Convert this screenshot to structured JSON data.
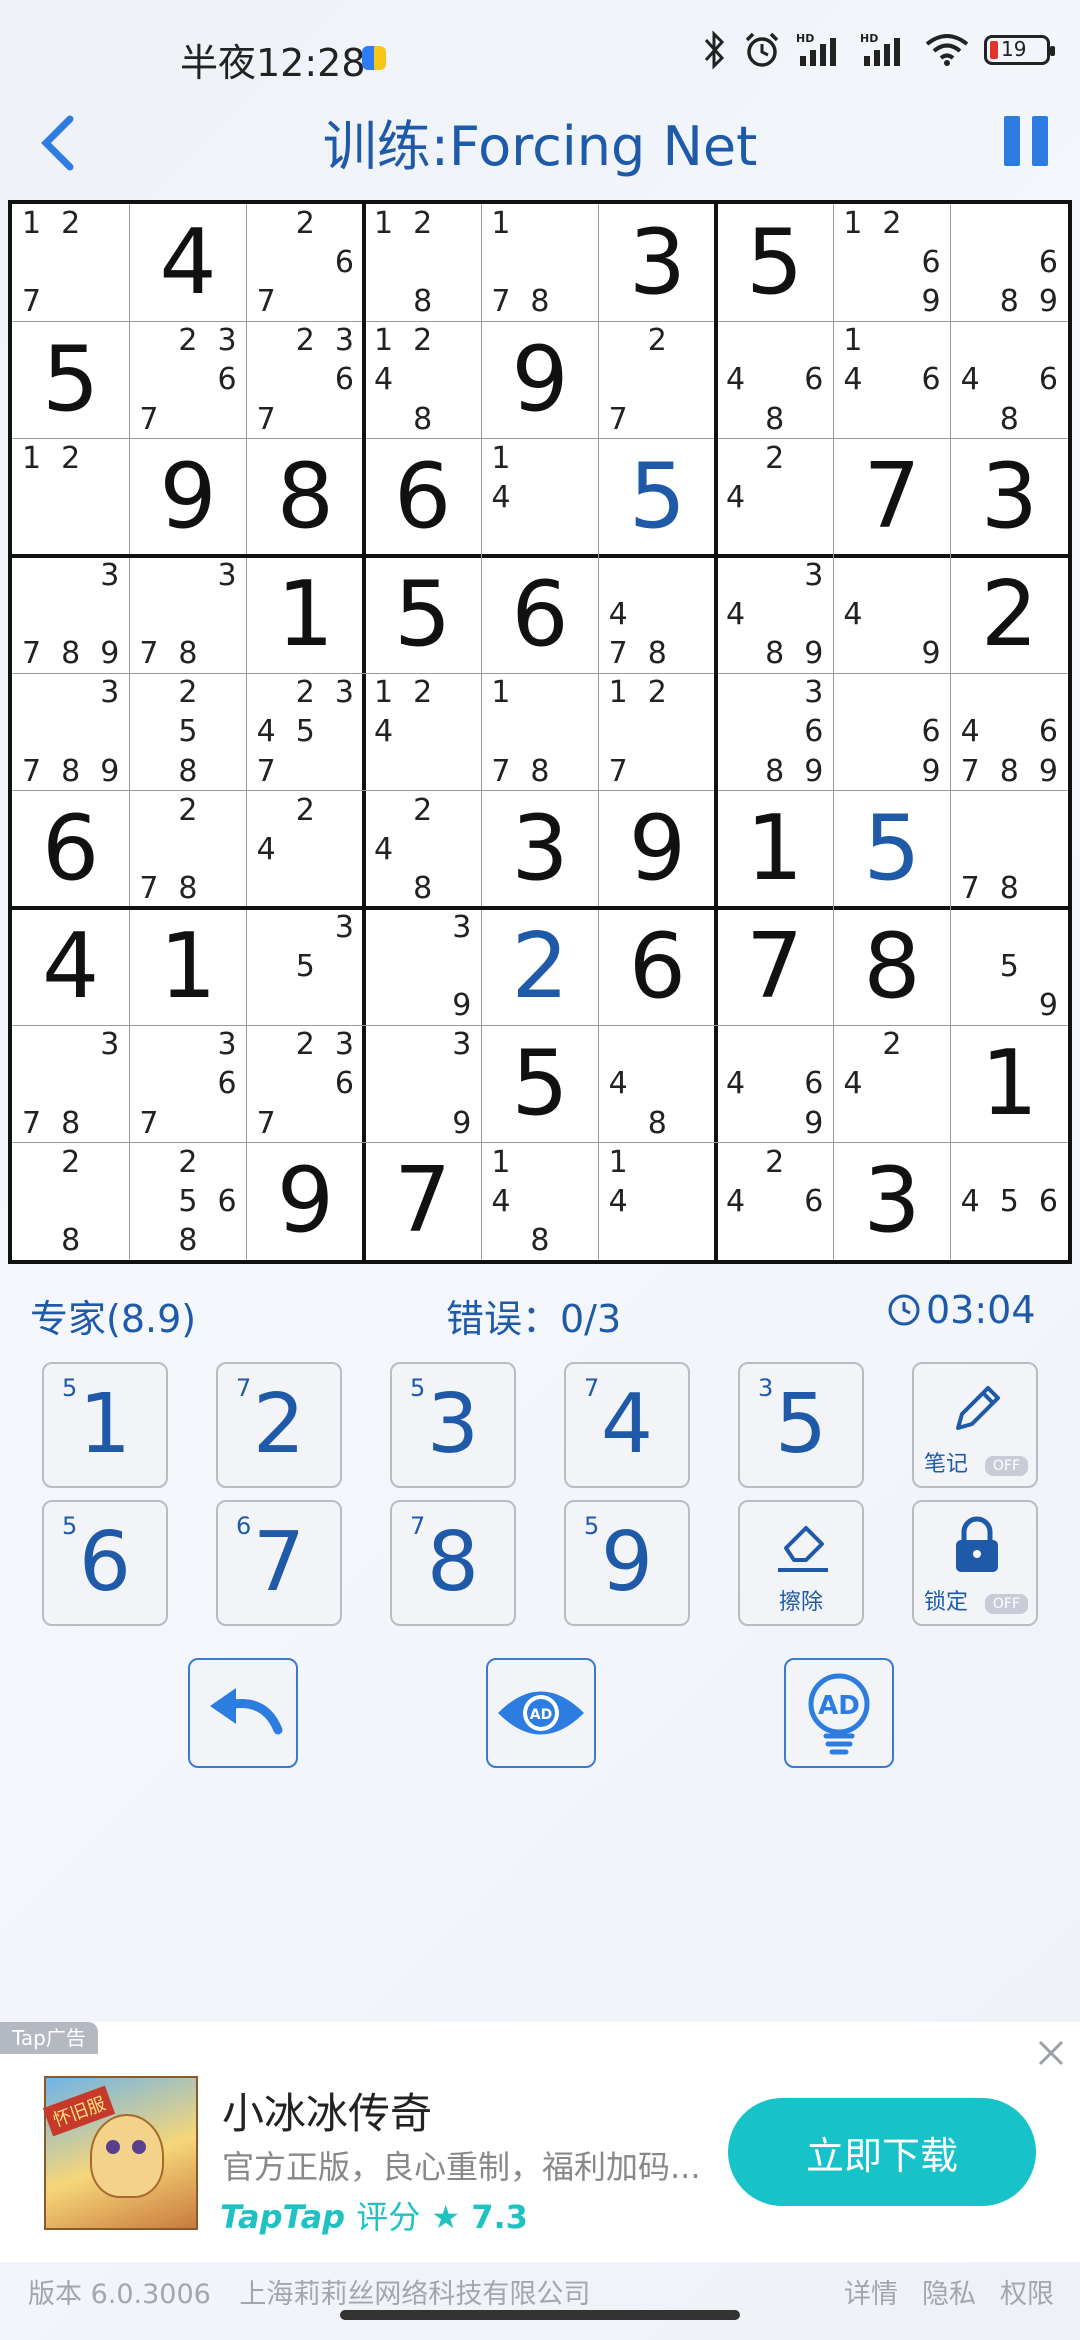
{
  "status_bar": {
    "time": "半夜12:28",
    "battery": "19"
  },
  "header": {
    "title": "训练:Forcing Net"
  },
  "grid": {
    "cells": [
      {
        "v": null,
        "c": [
          1,
          2,
          7
        ]
      },
      {
        "v": 4
      },
      {
        "v": null,
        "c": [
          2,
          6,
          7
        ]
      },
      {
        "v": null,
        "c": [
          1,
          2,
          8
        ]
      },
      {
        "v": null,
        "c": [
          1,
          7,
          8
        ]
      },
      {
        "v": 3
      },
      {
        "v": 5
      },
      {
        "v": null,
        "c": [
          1,
          2,
          6,
          9
        ]
      },
      {
        "v": null,
        "c": [
          6,
          8,
          9
        ]
      },
      {
        "v": 5
      },
      {
        "v": null,
        "c": [
          2,
          3,
          6,
          7
        ]
      },
      {
        "v": null,
        "c": [
          2,
          3,
          6,
          7
        ]
      },
      {
        "v": null,
        "c": [
          1,
          2,
          4,
          8
        ]
      },
      {
        "v": 9
      },
      {
        "v": null,
        "c": [
          2,
          7
        ]
      },
      {
        "v": null,
        "c": [
          4,
          6,
          8
        ]
      },
      {
        "v": null,
        "c": [
          1,
          4,
          6
        ]
      },
      {
        "v": null,
        "c": [
          4,
          6,
          8
        ]
      },
      {
        "v": null,
        "c": [
          1,
          2
        ]
      },
      {
        "v": 9
      },
      {
        "v": 8
      },
      {
        "v": 6
      },
      {
        "v": null,
        "c": [
          1,
          4
        ]
      },
      {
        "v": 5,
        "user": true
      },
      {
        "v": null,
        "c": [
          2,
          4
        ]
      },
      {
        "v": 7
      },
      {
        "v": 3
      },
      {
        "v": null,
        "c": [
          3,
          7,
          8,
          9
        ]
      },
      {
        "v": null,
        "c": [
          3,
          7,
          8
        ]
      },
      {
        "v": 1
      },
      {
        "v": 5
      },
      {
        "v": 6
      },
      {
        "v": null,
        "c": [
          4,
          7,
          8
        ]
      },
      {
        "v": null,
        "c": [
          3,
          4,
          8,
          9
        ]
      },
      {
        "v": null,
        "c": [
          4,
          9
        ]
      },
      {
        "v": 2
      },
      {
        "v": null,
        "c": [
          3,
          7,
          8,
          9
        ]
      },
      {
        "v": null,
        "c": [
          2,
          5,
          8
        ]
      },
      {
        "v": null,
        "c": [
          2,
          3,
          4,
          5,
          7
        ]
      },
      {
        "v": null,
        "c": [
          1,
          2,
          4
        ]
      },
      {
        "v": null,
        "c": [
          1,
          7,
          8
        ]
      },
      {
        "v": null,
        "c": [
          1,
          2,
          7
        ]
      },
      {
        "v": null,
        "c": [
          3,
          6,
          8,
          9
        ]
      },
      {
        "v": null,
        "c": [
          6,
          9
        ]
      },
      {
        "v": null,
        "c": [
          4,
          6,
          7,
          8,
          9
        ]
      },
      {
        "v": 6
      },
      {
        "v": null,
        "c": [
          2,
          7,
          8
        ]
      },
      {
        "v": null,
        "c": [
          2,
          4
        ]
      },
      {
        "v": null,
        "c": [
          2,
          4,
          8
        ]
      },
      {
        "v": 3
      },
      {
        "v": 9
      },
      {
        "v": 1
      },
      {
        "v": 5,
        "user": true
      },
      {
        "v": null,
        "c": [
          7,
          8
        ]
      },
      {
        "v": 4
      },
      {
        "v": 1
      },
      {
        "v": null,
        "c": [
          3,
          5
        ]
      },
      {
        "v": null,
        "c": [
          3,
          9
        ]
      },
      {
        "v": 2,
        "user": true
      },
      {
        "v": 6
      },
      {
        "v": 7
      },
      {
        "v": 8
      },
      {
        "v": null,
        "c": [
          5,
          9
        ]
      },
      {
        "v": null,
        "c": [
          3,
          7,
          8
        ]
      },
      {
        "v": null,
        "c": [
          3,
          6,
          7
        ]
      },
      {
        "v": null,
        "c": [
          2,
          3,
          6,
          7
        ]
      },
      {
        "v": null,
        "c": [
          3,
          9
        ]
      },
      {
        "v": 5
      },
      {
        "v": null,
        "c": [
          4,
          8
        ]
      },
      {
        "v": null,
        "c": [
          4,
          6,
          9
        ]
      },
      {
        "v": null,
        "c": [
          2,
          4
        ]
      },
      {
        "v": 1
      },
      {
        "v": null,
        "c": [
          2,
          8
        ]
      },
      {
        "v": null,
        "c": [
          2,
          5,
          6,
          8
        ]
      },
      {
        "v": 9
      },
      {
        "v": 7
      },
      {
        "v": null,
        "c": [
          1,
          4,
          8
        ]
      },
      {
        "v": null,
        "c": [
          1,
          4
        ]
      },
      {
        "v": null,
        "c": [
          2,
          4,
          6
        ]
      },
      {
        "v": 3
      },
      {
        "v": null,
        "c": [
          4,
          5,
          6
        ]
      }
    ]
  },
  "info": {
    "difficulty": "专家(8.9)",
    "mistakes": "错误：0/3",
    "timer": "03:04"
  },
  "keypad": {
    "numbers": [
      {
        "num": "1",
        "count": "5"
      },
      {
        "num": "2",
        "count": "7"
      },
      {
        "num": "3",
        "count": "5"
      },
      {
        "num": "4",
        "count": "7"
      },
      {
        "num": "5",
        "count": "3"
      },
      {
        "num": "6",
        "count": "5"
      },
      {
        "num": "7",
        "count": "6"
      },
      {
        "num": "8",
        "count": "7"
      },
      {
        "num": "9",
        "count": "5"
      }
    ],
    "notes_label": "笔记",
    "notes_state": "OFF",
    "erase_label": "擦除",
    "lock_label": "锁定",
    "lock_state": "OFF"
  },
  "ad": {
    "tag": "Tap广告",
    "title": "小冰冰传奇",
    "description": "官方正版，良心重制，福利加码...",
    "rating_brand": "TapTap",
    "rating_label": "评分",
    "rating_value": "★ 7.3",
    "cta": "立即下载",
    "image_badge": "怀旧服"
  },
  "footer": {
    "version": "版本 6.0.3006",
    "company": "上海莉莉丝网络科技有限公司",
    "links": [
      "详情",
      "隐私",
      "权限"
    ]
  },
  "colors": {
    "accent": "#1f5aa8",
    "cta": "#17c3c9"
  }
}
